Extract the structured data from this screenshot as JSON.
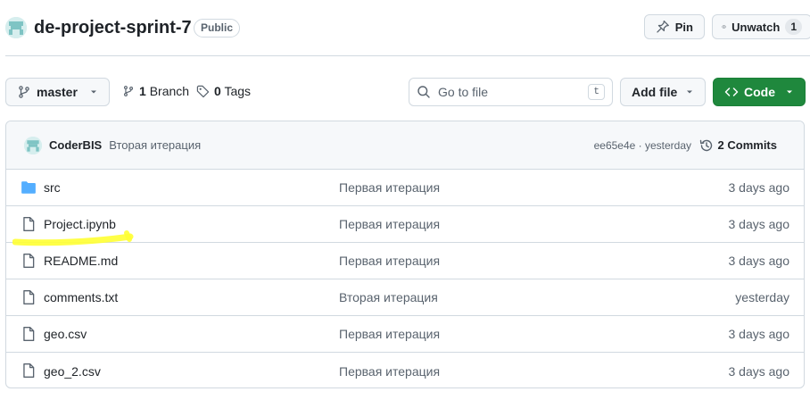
{
  "repo": {
    "name": "de-project-sprint-7",
    "visibility": "Public",
    "avatar_icon": "identicon"
  },
  "header_actions": {
    "pin_label": "Pin",
    "unwatch_label": "Unwatch",
    "watch_count": "1"
  },
  "toolbar": {
    "branch_name": "master",
    "branches_count": "1",
    "branches_label": "Branch",
    "tags_count": "0",
    "tags_label": "Tags",
    "search_placeholder": "Go to file",
    "search_shortcut": "t",
    "add_file_label": "Add file",
    "code_label": "Code"
  },
  "latest_commit": {
    "author": "CoderBIS",
    "message": "Вторая итерация",
    "hash_time": "ee65e4e · yesterday",
    "commits_count": "2",
    "commits_label": "Commits"
  },
  "files": [
    {
      "type": "folder",
      "name": "src",
      "message": "Первая итерация",
      "date": "3 days ago"
    },
    {
      "type": "file",
      "name": "Project.ipynb",
      "message": "Первая итерация",
      "date": "3 days ago"
    },
    {
      "type": "file",
      "name": "README.md",
      "message": "Первая итерация",
      "date": "3 days ago"
    },
    {
      "type": "file",
      "name": "comments.txt",
      "message": "Вторая итерация",
      "date": "yesterday"
    },
    {
      "type": "file",
      "name": "geo.csv",
      "message": "Первая итерация",
      "date": "3 days ago"
    },
    {
      "type": "file",
      "name": "geo_2.csv",
      "message": "Первая итерация",
      "date": "3 days ago"
    }
  ],
  "colors": {
    "code_button": "#1f883d",
    "folder_icon": "#54aeff",
    "highlight_marker": "#ffff33"
  }
}
